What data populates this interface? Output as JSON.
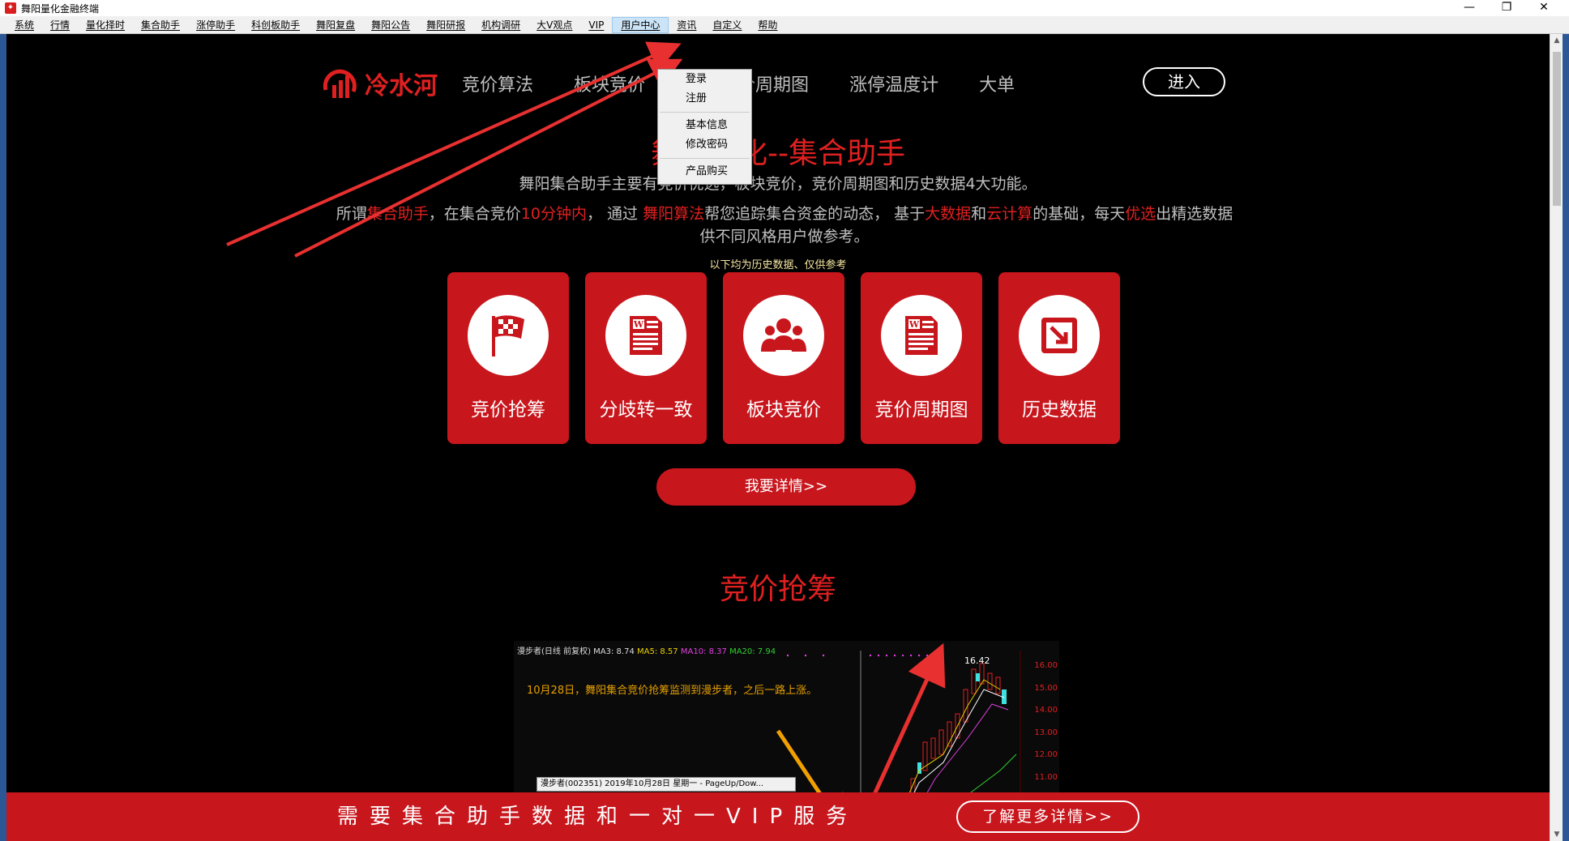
{
  "window": {
    "title": "舞阳量化金融终端"
  },
  "menubar": {
    "items": [
      "系统",
      "行情",
      "量化择时",
      "集合助手",
      "涨停助手",
      "科创板助手",
      "舞阳复盘",
      "舞阳公告",
      "舞阳研报",
      "机构调研",
      "大V观点",
      "VIP",
      "用户中心",
      "资讯",
      "自定义",
      "帮助"
    ],
    "active": "用户中心"
  },
  "dropdown": {
    "items": [
      "登录",
      "注册",
      "基本信息",
      "修改密码",
      "产品购买"
    ]
  },
  "topnav": {
    "logo": "冷水河",
    "links": [
      "竞价算法",
      "板块竞价",
      "板",
      "竞价周期图",
      "涨停温度计",
      "大单"
    ],
    "enter": "进入"
  },
  "hero": {
    "title": "舞阳量化--集合助手",
    "subtitle": "舞阳集合助手主要有竞价优选，板块竞价，竞价周期图和历史数据4大功能。",
    "desc": {
      "p1": "所谓",
      "h1": "集合助手",
      "p2": "，在集合竞价",
      "h2": "10分钟内",
      "p3": "， 通过 ",
      "h3": "舞阳算法",
      "p4": "帮您追踪集合资金的动态， 基于",
      "h4": "大数据",
      "p5": "和",
      "h5": "云计算",
      "p6": "的基础，每天",
      "h6": "优选",
      "p7": "出精选数据",
      "line2": "供不同风格用户做参考。"
    },
    "note": "以下均为历史数据、仅供参考"
  },
  "cards": [
    "竞价抢筹",
    "分歧转一致",
    "板块竞价",
    "竞价周期图",
    "历史数据"
  ],
  "detail_button": "我要详情>>",
  "section": {
    "title": "竞价抢筹"
  },
  "chart_shot": {
    "header_name": "漫步者(日线 前复权)",
    "ma3": "MA3: 8.74",
    "ma5": "MA5: 8.57",
    "ma10": "MA10: 8.37",
    "ma20": "MA20: 7.94",
    "annotation": "10月28日，舞阳集合竞价抢筹监测到漫步者，之后一路上涨。",
    "peak": "16.42",
    "axis": [
      "16.00",
      "15.00",
      "14.00",
      "13.00",
      "12.00",
      "11.00"
    ],
    "popup": "漫步者(002351) 2019年10月28日 星期一 - PageUp/Dow..."
  },
  "banner": {
    "text": "需要集合助手数据和一对一VIP服务",
    "button": "了解更多详情>>"
  },
  "colors": {
    "brand_red": "#c8161d",
    "accent_red": "#e02020",
    "bg": "#000000"
  }
}
